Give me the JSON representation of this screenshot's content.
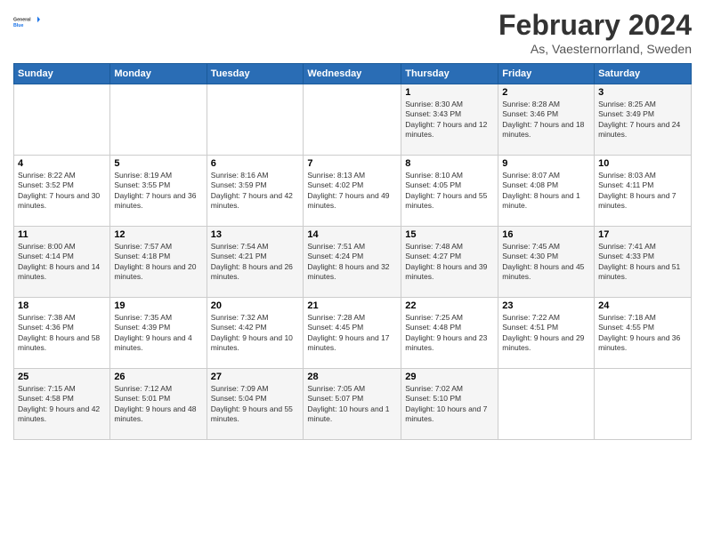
{
  "header": {
    "logo_line1": "General",
    "logo_line2": "Blue",
    "month_title": "February 2024",
    "subtitle": "As, Vaesternorrland, Sweden"
  },
  "weekdays": [
    "Sunday",
    "Monday",
    "Tuesday",
    "Wednesday",
    "Thursday",
    "Friday",
    "Saturday"
  ],
  "weeks": [
    [
      null,
      null,
      null,
      null,
      {
        "day": 1,
        "sunrise": "8:30 AM",
        "sunset": "3:43 PM",
        "daylight": "7 hours and 12 minutes."
      },
      {
        "day": 2,
        "sunrise": "8:28 AM",
        "sunset": "3:46 PM",
        "daylight": "7 hours and 18 minutes."
      },
      {
        "day": 3,
        "sunrise": "8:25 AM",
        "sunset": "3:49 PM",
        "daylight": "7 hours and 24 minutes."
      }
    ],
    [
      {
        "day": 4,
        "sunrise": "8:22 AM",
        "sunset": "3:52 PM",
        "daylight": "7 hours and 30 minutes."
      },
      {
        "day": 5,
        "sunrise": "8:19 AM",
        "sunset": "3:55 PM",
        "daylight": "7 hours and 36 minutes."
      },
      {
        "day": 6,
        "sunrise": "8:16 AM",
        "sunset": "3:59 PM",
        "daylight": "7 hours and 42 minutes."
      },
      {
        "day": 7,
        "sunrise": "8:13 AM",
        "sunset": "4:02 PM",
        "daylight": "7 hours and 49 minutes."
      },
      {
        "day": 8,
        "sunrise": "8:10 AM",
        "sunset": "4:05 PM",
        "daylight": "7 hours and 55 minutes."
      },
      {
        "day": 9,
        "sunrise": "8:07 AM",
        "sunset": "4:08 PM",
        "daylight": "8 hours and 1 minute."
      },
      {
        "day": 10,
        "sunrise": "8:03 AM",
        "sunset": "4:11 PM",
        "daylight": "8 hours and 7 minutes."
      }
    ],
    [
      {
        "day": 11,
        "sunrise": "8:00 AM",
        "sunset": "4:14 PM",
        "daylight": "8 hours and 14 minutes."
      },
      {
        "day": 12,
        "sunrise": "7:57 AM",
        "sunset": "4:18 PM",
        "daylight": "8 hours and 20 minutes."
      },
      {
        "day": 13,
        "sunrise": "7:54 AM",
        "sunset": "4:21 PM",
        "daylight": "8 hours and 26 minutes."
      },
      {
        "day": 14,
        "sunrise": "7:51 AM",
        "sunset": "4:24 PM",
        "daylight": "8 hours and 32 minutes."
      },
      {
        "day": 15,
        "sunrise": "7:48 AM",
        "sunset": "4:27 PM",
        "daylight": "8 hours and 39 minutes."
      },
      {
        "day": 16,
        "sunrise": "7:45 AM",
        "sunset": "4:30 PM",
        "daylight": "8 hours and 45 minutes."
      },
      {
        "day": 17,
        "sunrise": "7:41 AM",
        "sunset": "4:33 PM",
        "daylight": "8 hours and 51 minutes."
      }
    ],
    [
      {
        "day": 18,
        "sunrise": "7:38 AM",
        "sunset": "4:36 PM",
        "daylight": "8 hours and 58 minutes."
      },
      {
        "day": 19,
        "sunrise": "7:35 AM",
        "sunset": "4:39 PM",
        "daylight": "9 hours and 4 minutes."
      },
      {
        "day": 20,
        "sunrise": "7:32 AM",
        "sunset": "4:42 PM",
        "daylight": "9 hours and 10 minutes."
      },
      {
        "day": 21,
        "sunrise": "7:28 AM",
        "sunset": "4:45 PM",
        "daylight": "9 hours and 17 minutes."
      },
      {
        "day": 22,
        "sunrise": "7:25 AM",
        "sunset": "4:48 PM",
        "daylight": "9 hours and 23 minutes."
      },
      {
        "day": 23,
        "sunrise": "7:22 AM",
        "sunset": "4:51 PM",
        "daylight": "9 hours and 29 minutes."
      },
      {
        "day": 24,
        "sunrise": "7:18 AM",
        "sunset": "4:55 PM",
        "daylight": "9 hours and 36 minutes."
      }
    ],
    [
      {
        "day": 25,
        "sunrise": "7:15 AM",
        "sunset": "4:58 PM",
        "daylight": "9 hours and 42 minutes."
      },
      {
        "day": 26,
        "sunrise": "7:12 AM",
        "sunset": "5:01 PM",
        "daylight": "9 hours and 48 minutes."
      },
      {
        "day": 27,
        "sunrise": "7:09 AM",
        "sunset": "5:04 PM",
        "daylight": "9 hours and 55 minutes."
      },
      {
        "day": 28,
        "sunrise": "7:05 AM",
        "sunset": "5:07 PM",
        "daylight": "10 hours and 1 minute."
      },
      {
        "day": 29,
        "sunrise": "7:02 AM",
        "sunset": "5:10 PM",
        "daylight": "10 hours and 7 minutes."
      },
      null,
      null
    ]
  ],
  "labels": {
    "sunrise_label": "Sunrise:",
    "sunset_label": "Sunset:",
    "daylight_label": "Daylight:"
  }
}
